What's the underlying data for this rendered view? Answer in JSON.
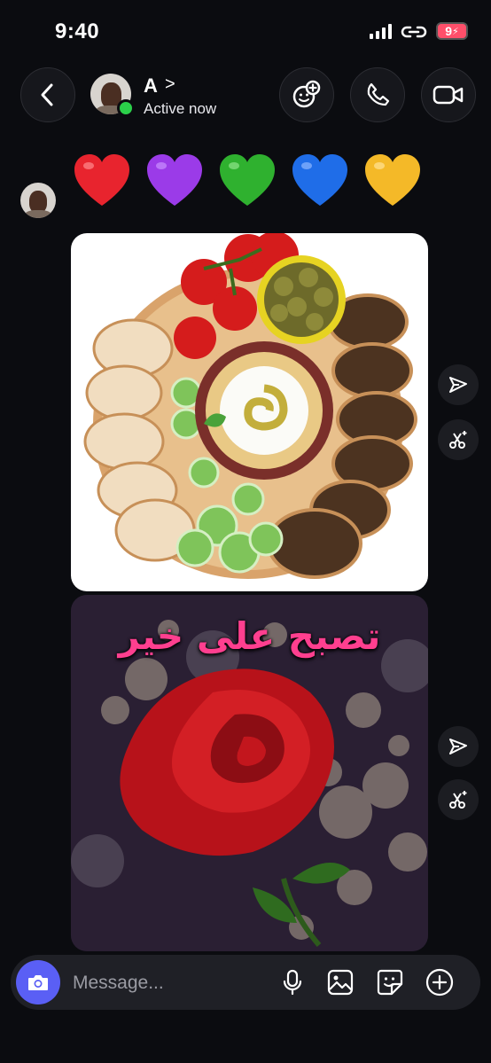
{
  "status_bar": {
    "time": "9:40",
    "battery": "9"
  },
  "header": {
    "contact_name": "A",
    "chevron": ">",
    "status": "Active now"
  },
  "messages": {
    "reaction_emojis": [
      "red-heart",
      "purple-heart",
      "green-heart",
      "blue-heart",
      "yellow-heart"
    ],
    "image_2_caption": "تصبح على خير"
  },
  "composer": {
    "placeholder": "Message..."
  },
  "colors": {
    "accent": "#5a5ff5",
    "online": "#2bd04a",
    "background": "#0b0c10"
  }
}
